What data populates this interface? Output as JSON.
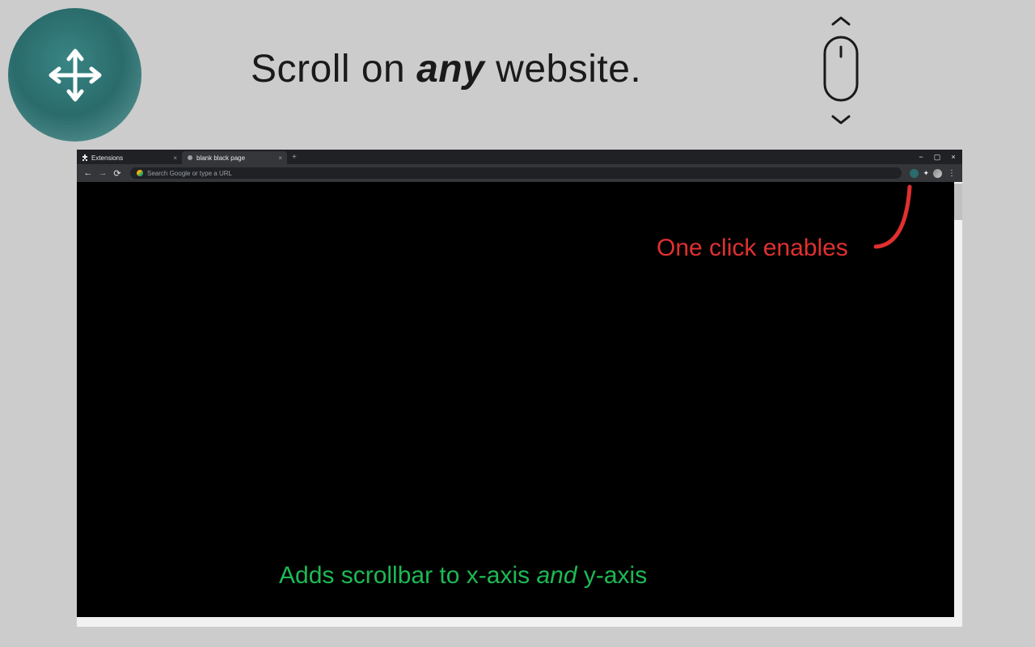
{
  "headline": {
    "part1": "Scroll on ",
    "emphasis": "any",
    "part2": " website."
  },
  "browser": {
    "tabs": [
      {
        "label": "Extensions",
        "active": false
      },
      {
        "label": "blank black page",
        "active": true
      }
    ],
    "address_placeholder": "Search Google or type a URL"
  },
  "annotations": {
    "red": "One click enables",
    "green_part1": "Adds scrollbar to x-axis ",
    "green_emphasis": "and",
    "green_part2": " y-axis"
  },
  "colors": {
    "background": "#cccccc",
    "logo_teal": "#2a6b6b",
    "annotation_red": "#e03030",
    "annotation_green": "#1db954",
    "browser_dark": "#202124",
    "browser_toolbar": "#35363a"
  }
}
